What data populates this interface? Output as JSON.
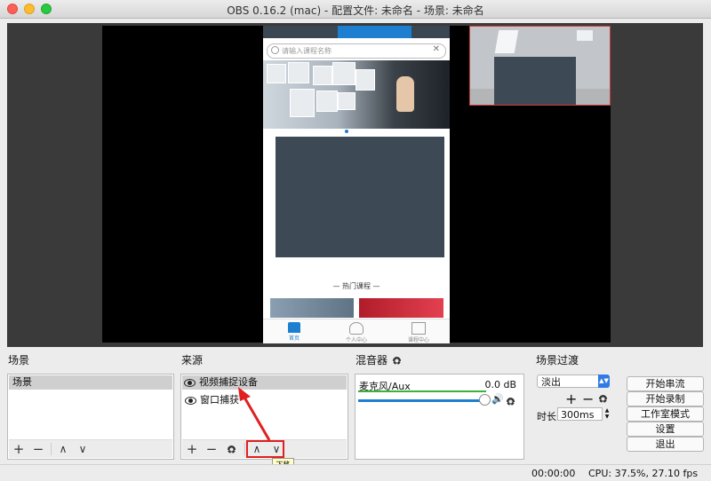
{
  "window": {
    "title": "OBS 0.16.2 (mac) - 配置文件: 未命名 - 场景: 未命名"
  },
  "preview": {
    "search_placeholder": "请输入课程名称",
    "hot_courses_label": "—  热门课程  —",
    "tabs": [
      {
        "label": "首页",
        "icon": "home-icon"
      },
      {
        "label": "个人中心",
        "icon": "person-icon"
      },
      {
        "label": "课程中心",
        "icon": "book-icon"
      }
    ],
    "colors": {
      "accent": "#1e7fd1",
      "placeholder_block": "#3d4a55"
    }
  },
  "scenes": {
    "header": "场景",
    "items": [
      "场景"
    ]
  },
  "sources": {
    "header": "来源",
    "items": [
      "视频捕捉设备",
      "窗口捕获"
    ]
  },
  "mixer": {
    "header": "混音器",
    "channel": "麦克风/Aux",
    "level": "0.0 dB"
  },
  "transitions": {
    "header": "场景过渡",
    "selected": "淡出",
    "duration_label": "时长",
    "duration_value": "300ms"
  },
  "controls": {
    "buttons": [
      "开始串流",
      "开始录制",
      "工作室模式",
      "设置",
      "退出"
    ]
  },
  "tooltip": "下移",
  "status": {
    "time": "00:00:00",
    "cpu": "CPU: 37.5%, 27.10 fps"
  }
}
